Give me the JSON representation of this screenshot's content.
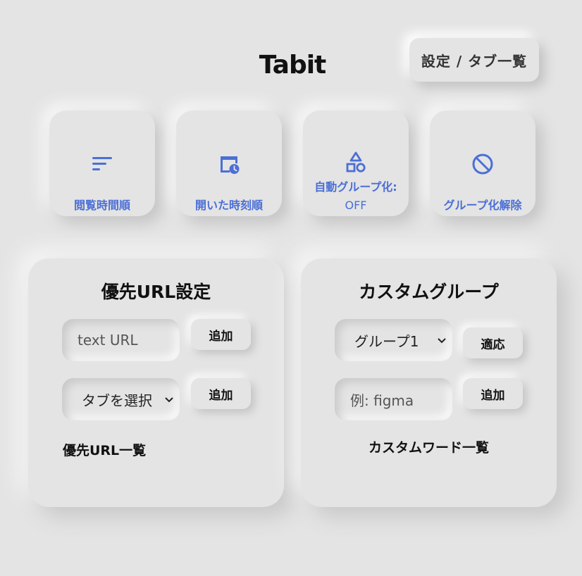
{
  "header": {
    "title": "Tabit",
    "settings_label": "設定 / タブ一覧"
  },
  "sort_buttons": [
    {
      "label": "閲覧時間順",
      "icon": "sort-lines-icon"
    },
    {
      "label": "開いた時刻順",
      "icon": "window-clock-icon"
    },
    {
      "label_line1": "自動グループ化:",
      "label_line2": "OFF",
      "icon": "shapes-icon"
    },
    {
      "label": "グループ化解除",
      "icon": "block-icon"
    }
  ],
  "priority_panel": {
    "title": "優先URL設定",
    "url_input_placeholder": "text URL",
    "add_label_1": "追加",
    "tab_select_value": "タブを選択",
    "add_label_2": "追加",
    "list_heading": "優先URL一覧"
  },
  "custom_panel": {
    "title": "カスタムグループ",
    "group_select_value": "グループ1",
    "apply_label": "適応",
    "word_input_placeholder": "例: figma",
    "add_label": "追加",
    "list_heading": "カスタムワード一覧"
  },
  "colors": {
    "background": "#e4e4e4",
    "accent": "#4b6fd6",
    "text": "#111111"
  }
}
